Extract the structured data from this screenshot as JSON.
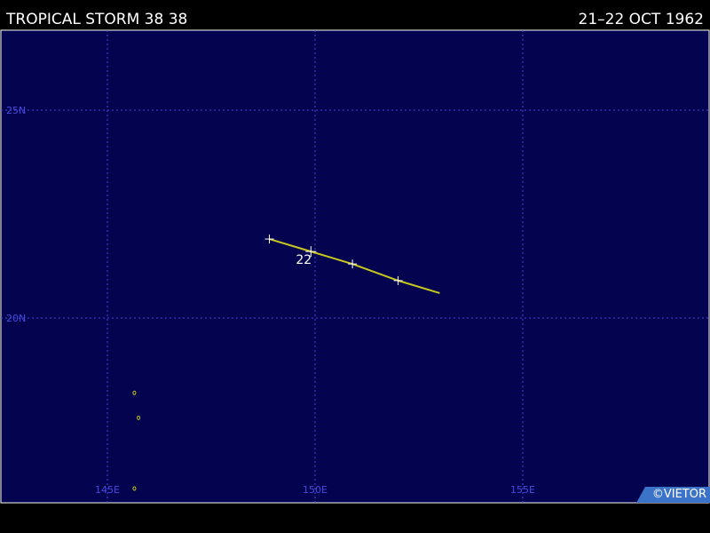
{
  "header": {
    "title": "TROPICAL STORM 38 38",
    "dates": "21–22 OCT 1962"
  },
  "map": {
    "background_color": "#03034f",
    "grid_color": "#4a4ae0",
    "track_color": "#c8c820",
    "label_color": "#4a4ae0",
    "longitude_labels": [
      "145E",
      "150E",
      "155E"
    ],
    "latitude_labels": [
      "25N",
      "20N"
    ],
    "track_date_label": "22",
    "storm_track": [
      {
        "lon": 148.9,
        "lat": 21.9
      },
      {
        "lon": 149.9,
        "lat": 21.6
      },
      {
        "lon": 150.9,
        "lat": 21.3
      },
      {
        "lon": 152.0,
        "lat": 20.9
      },
      {
        "lon": 153.0,
        "lat": 20.6
      }
    ],
    "track_markers": [
      {
        "lon": 148.9,
        "lat": 21.9
      },
      {
        "lon": 149.9,
        "lat": 21.6
      },
      {
        "lon": 150.9,
        "lat": 21.3
      },
      {
        "lon": 152.0,
        "lat": 20.9
      }
    ],
    "islands": [
      {
        "lon": 145.65,
        "lat": 18.2
      },
      {
        "lon": 145.75,
        "lat": 17.6
      },
      {
        "lon": 145.65,
        "lat": 15.9
      }
    ]
  },
  "credit": "©VIETOR"
}
